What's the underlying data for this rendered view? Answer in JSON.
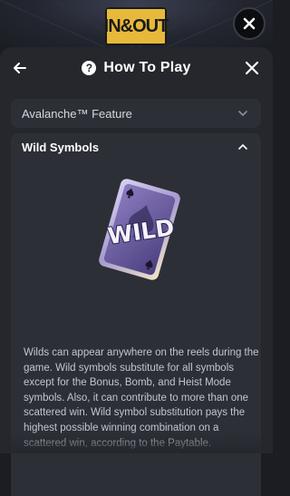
{
  "game": {
    "logo_text": "IN&OUT"
  },
  "header": {
    "title": "How To Play"
  },
  "sections": {
    "avalanche": {
      "label": "Avalanche™ Feature"
    },
    "wild": {
      "title": "Wild Symbols",
      "card_text": "WILD",
      "description": "Wilds can appear anywhere on the reels during the game. Wild symbols substitute for all symbols except for the Bonus, Bomb, and Heist Mode symbols. Also, it can contribute to more than one scattered win. Wild symbol substitution pays the highest possible winning combination on a scattered win, according to the Paytable."
    }
  },
  "icons": {
    "back": "arrow-left-icon",
    "help": "question-circle-icon",
    "close": "close-icon",
    "chevron_down": "chevron-down-icon",
    "chevron_up": "chevron-up-icon",
    "spade": "spade-icon"
  },
  "colors": {
    "panel_bg": "#25272d",
    "accordion_bg": "#2c2f36",
    "card_purple": "#6a5a9e",
    "logo_gold": "#e7b93a"
  }
}
